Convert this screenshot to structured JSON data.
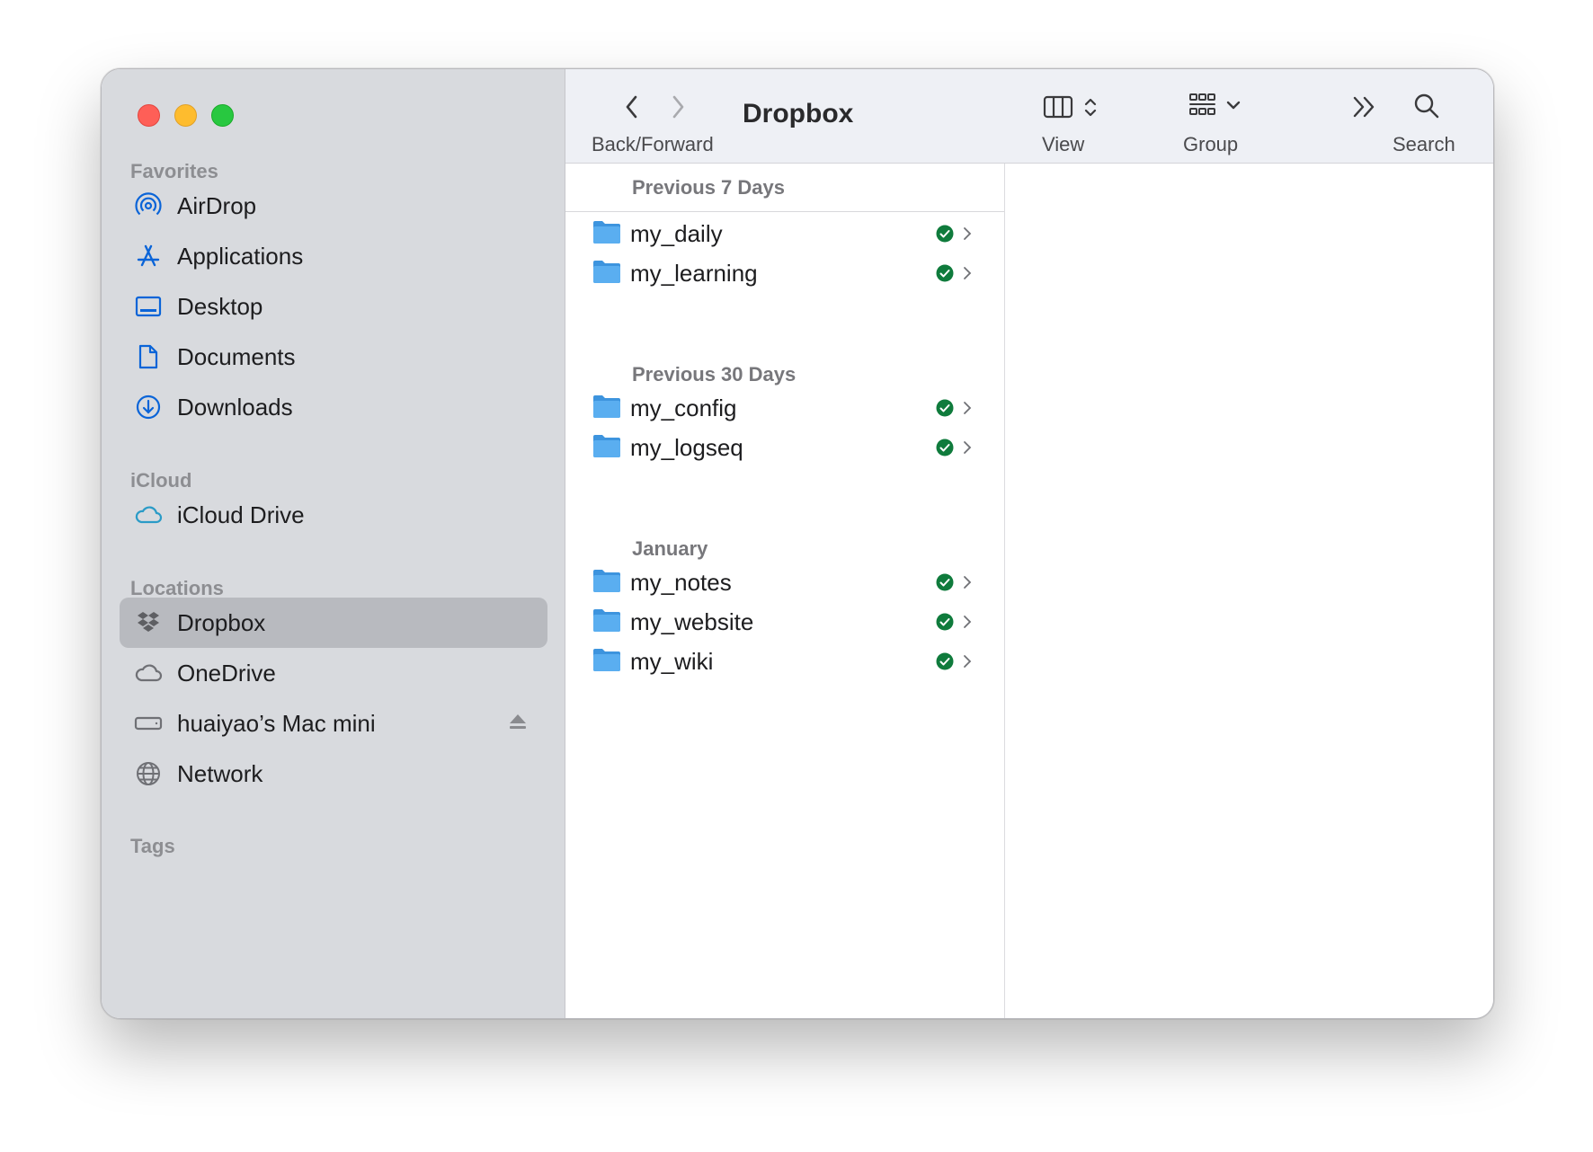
{
  "sidebar": {
    "sections": {
      "favorites": "Favorites",
      "icloud": "iCloud",
      "locations": "Locations",
      "tags": "Tags"
    },
    "favorites": [
      {
        "label": "AirDrop",
        "icon": "airdrop-icon"
      },
      {
        "label": "Applications",
        "icon": "applications-icon"
      },
      {
        "label": "Desktop",
        "icon": "desktop-icon"
      },
      {
        "label": "Documents",
        "icon": "document-icon"
      },
      {
        "label": "Downloads",
        "icon": "download-icon"
      }
    ],
    "icloud": [
      {
        "label": "iCloud Drive",
        "icon": "cloud-icon"
      }
    ],
    "locations": [
      {
        "label": "Dropbox",
        "icon": "dropbox-icon",
        "selected": true
      },
      {
        "label": "OneDrive",
        "icon": "cloud-icon"
      },
      {
        "label": "huaiyao’s Mac mini",
        "icon": "drive-icon"
      },
      {
        "label": "Network",
        "icon": "globe-icon"
      }
    ]
  },
  "toolbar": {
    "title": "Dropbox",
    "back_forward_label": "Back/Forward",
    "view_label": "View",
    "group_label": "Group",
    "search_label": "Search"
  },
  "groups": [
    {
      "title": "Previous 7 Days",
      "items": [
        "my_daily",
        "my_learning"
      ]
    },
    {
      "title": "Previous 30 Days",
      "items": [
        "my_config",
        "my_logseq"
      ]
    },
    {
      "title": "January",
      "items": [
        "my_notes",
        "my_website",
        "my_wiki"
      ]
    }
  ],
  "colors": {
    "sidebar_bg": "#d8dade",
    "selection": "#b8babf",
    "accent_blue": "#0a64d8",
    "synced_green": "#0f7b3c",
    "folder_blue": "#5aaef0"
  }
}
